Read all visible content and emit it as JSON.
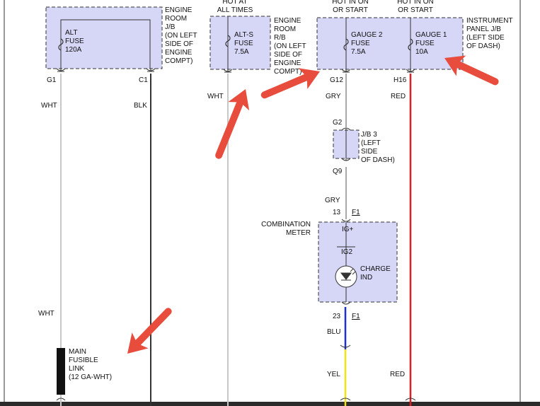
{
  "colors": {
    "wire_white": "#c8c8c8",
    "wire_black": "#333333",
    "wire_gray": "#a8a8a8",
    "wire_red": "#e02020",
    "wire_blue": "#1f2fd0",
    "wire_yellow": "#f2e21a",
    "box_fill": "#d6d6f7",
    "annotation_arrow": "#e84c3d"
  },
  "engine_room_jb": {
    "label": [
      "ENGINE",
      "ROOM",
      "J/B",
      "(ON LEFT",
      "SIDE OF",
      "ENGINE",
      "COMPT)"
    ],
    "fuse_label": [
      "ALT",
      "FUSE",
      "120A"
    ],
    "terminal_left": "G1",
    "terminal_right": "C1"
  },
  "engine_room_rb": {
    "header": [
      "HOT AT",
      "ALL TIMES"
    ],
    "label": [
      "ENGINE",
      "ROOM",
      "R/B",
      "(ON LEFT",
      "SIDE OF",
      "ENGINE",
      "COMPT)"
    ],
    "fuse_label": [
      "ALT-S",
      "FUSE",
      "7.5A"
    ]
  },
  "instrument_panel_jb": {
    "header_left": [
      "HOT IN ON",
      "OR START"
    ],
    "header_right": [
      "HOT IN ON",
      "OR START"
    ],
    "label": [
      "INSTRUMENT",
      "PANEL J/B",
      "(LEFT SIDE",
      "OF DASH)"
    ],
    "gauge2_label": [
      "GAUGE 2",
      "FUSE",
      "7.5A"
    ],
    "gauge1_label": [
      "GAUGE 1",
      "FUSE",
      "10A"
    ],
    "terminal_left": "G12",
    "terminal_right": "H16"
  },
  "wires": {
    "wht_top": "WHT",
    "blk": "BLK",
    "wht_mid": "WHT",
    "gry_top": "GRY",
    "red_top": "RED",
    "wht_lower": "WHT",
    "gry_mid": "GRY",
    "blu": "BLU",
    "yel": "YEL",
    "red_bottom": "RED"
  },
  "jb3": {
    "label": [
      "J/B 3",
      "(LEFT",
      "SIDE",
      "OF DASH)"
    ],
    "terminal_top": "G2",
    "terminal_bottom": "Q9"
  },
  "combination_meter": {
    "label": [
      "COMBINATION",
      "METER"
    ],
    "pin_top": "13",
    "connector_top": "F1",
    "ig_plus": "IG+",
    "ig2": "IG2",
    "charge_label": [
      "CHARGE",
      "IND"
    ],
    "pin_bottom": "23",
    "connector_bottom": "F1"
  },
  "fusible_link": {
    "label": [
      "MAIN",
      "FUSIBLE",
      "LINK",
      "(12 GA-WHT)"
    ]
  }
}
